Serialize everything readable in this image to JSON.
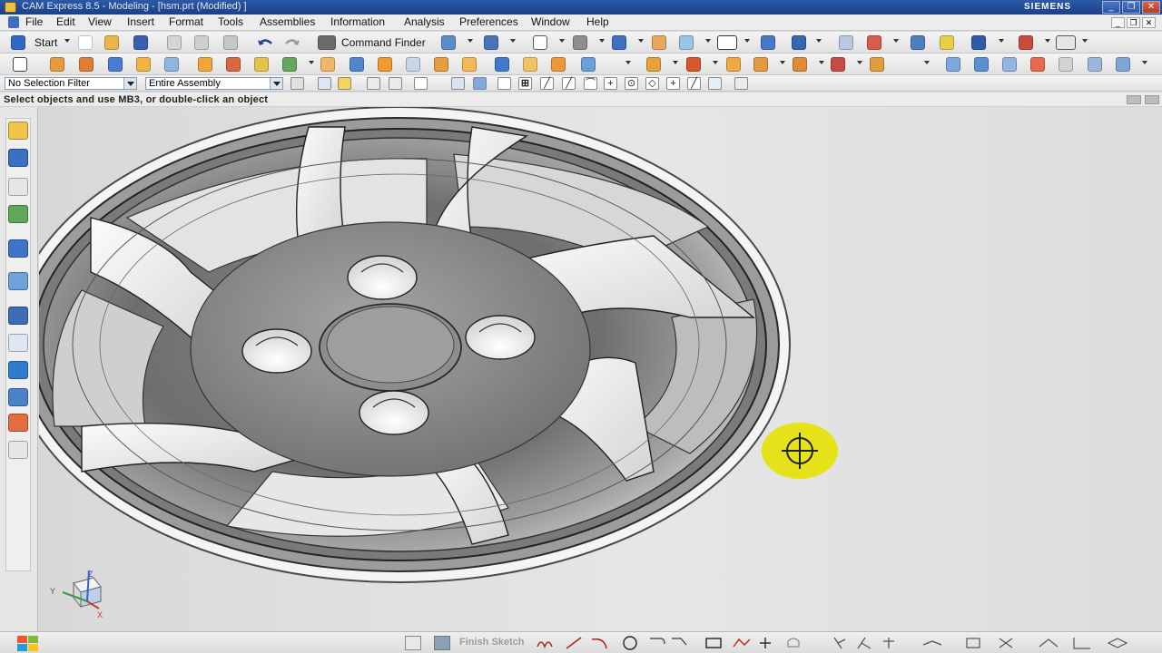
{
  "window": {
    "title": "CAM Express 8.5 - Modeling - [hsm.prt (Modified) ]",
    "brand": "SIEMENS",
    "controls": [
      "_",
      "❐",
      "✕"
    ]
  },
  "menubar": {
    "items": [
      "File",
      "Edit",
      "View",
      "Insert",
      "Format",
      "Tools",
      "Assemblies",
      "Information",
      "Analysis",
      "Preferences",
      "Window",
      "Help"
    ],
    "mdi_controls": [
      "_",
      "❐",
      "✕"
    ]
  },
  "toolbar1": {
    "start_label": "Start",
    "command_finder_label": "Command Finder"
  },
  "selection_bar": {
    "type_filter": "No Selection Filter",
    "scope": "Entire Assembly"
  },
  "status_line": {
    "text": "Select objects and use MB3, or double-click an object"
  },
  "cue_bar": {
    "finish_sketch_label": "Finish Sketch"
  },
  "viewport": {
    "triad_labels": {
      "x": "X",
      "y": "Y",
      "z": "Z"
    }
  },
  "colors": {
    "title_bar": "#1f4a98",
    "cursor_highlight": "#e6e21a",
    "background": "#dcdcdc"
  },
  "icons": {
    "toolbar1": [
      "start-icon",
      "new-icon",
      "open-icon",
      "save-icon",
      "cut-icon",
      "copy-icon",
      "paste-icon",
      "undo-icon",
      "redo-icon",
      "command-finder-icon"
    ],
    "resource_bar": [
      "assembly-navigator-icon",
      "constraint-navigator-icon",
      "part-navigator-icon",
      "reuse-library-icon",
      "web-browser-icon",
      "history-icon",
      "system-materials-icon",
      "process-studio-icon",
      "roles-icon",
      "system-scenes-icon"
    ]
  }
}
